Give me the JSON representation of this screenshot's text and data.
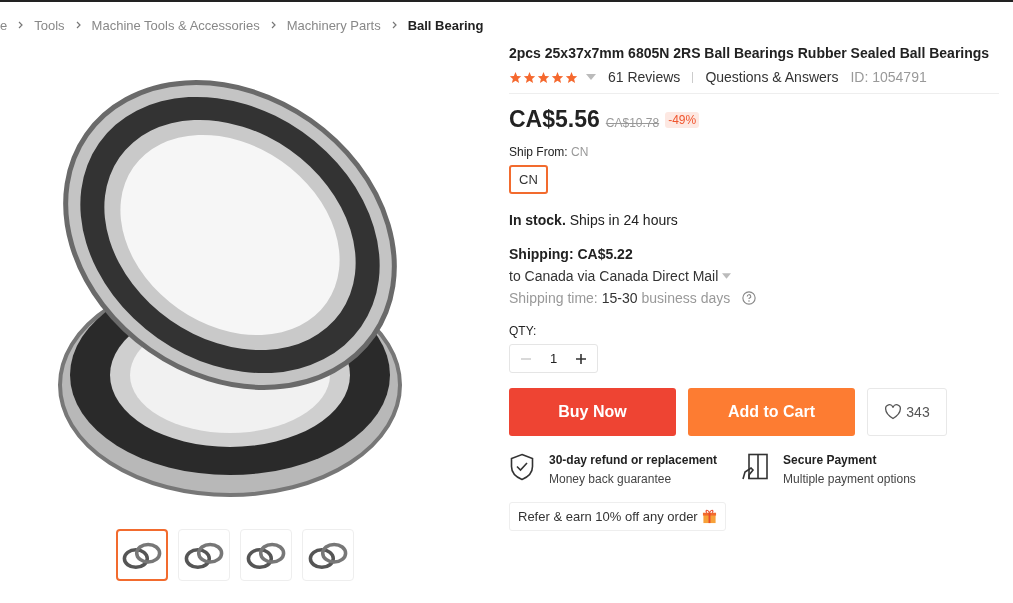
{
  "breadcrumb": [
    {
      "label": "e",
      "current": false
    },
    {
      "label": "Tools",
      "current": false
    },
    {
      "label": "Machine Tools & Accessories",
      "current": false
    },
    {
      "label": "Machinery Parts",
      "current": false
    },
    {
      "label": "Ball Bearing",
      "current": true
    }
  ],
  "gallery": {
    "thumbnails": [
      {
        "selected": true
      },
      {
        "selected": false
      },
      {
        "selected": false
      },
      {
        "selected": false
      }
    ]
  },
  "product": {
    "title": "2pcs 25x37x7mm 6805N 2RS Ball Bearings Rubber Sealed Ball Bearings",
    "stars": 5,
    "reviews": "61 Reviews",
    "qa": "Questions & Answers",
    "id": "ID: 1054791",
    "price": "CA$5.56",
    "old_price": "CA$10.78",
    "discount": "-49%",
    "ship_from_label": "Ship From:",
    "ship_from_value": "CN",
    "ship_options": [
      {
        "label": "CN",
        "selected": true
      }
    ],
    "stock_bold": "In stock.",
    "stock_text": "Ships in 24 hours",
    "shipping": "Shipping: CA$5.22",
    "shipping_route": "to Canada via Canada Direct Mail",
    "shipping_time_label": "Shipping time:",
    "shipping_time_value": "15-30",
    "shipping_time_unit": "business days",
    "qty_label": "QTY:",
    "qty": "1",
    "buy_now": "Buy Now",
    "add_to_cart": "Add to Cart",
    "wishlist_count": "343",
    "guarantees": [
      {
        "kind": "shield",
        "title": "30-day refund or replacement",
        "text": "Money back guarantee"
      },
      {
        "kind": "payment",
        "title": "Secure Payment",
        "text": "Multiple payment options"
      }
    ],
    "referral": "Refer & earn 10% off any order"
  }
}
